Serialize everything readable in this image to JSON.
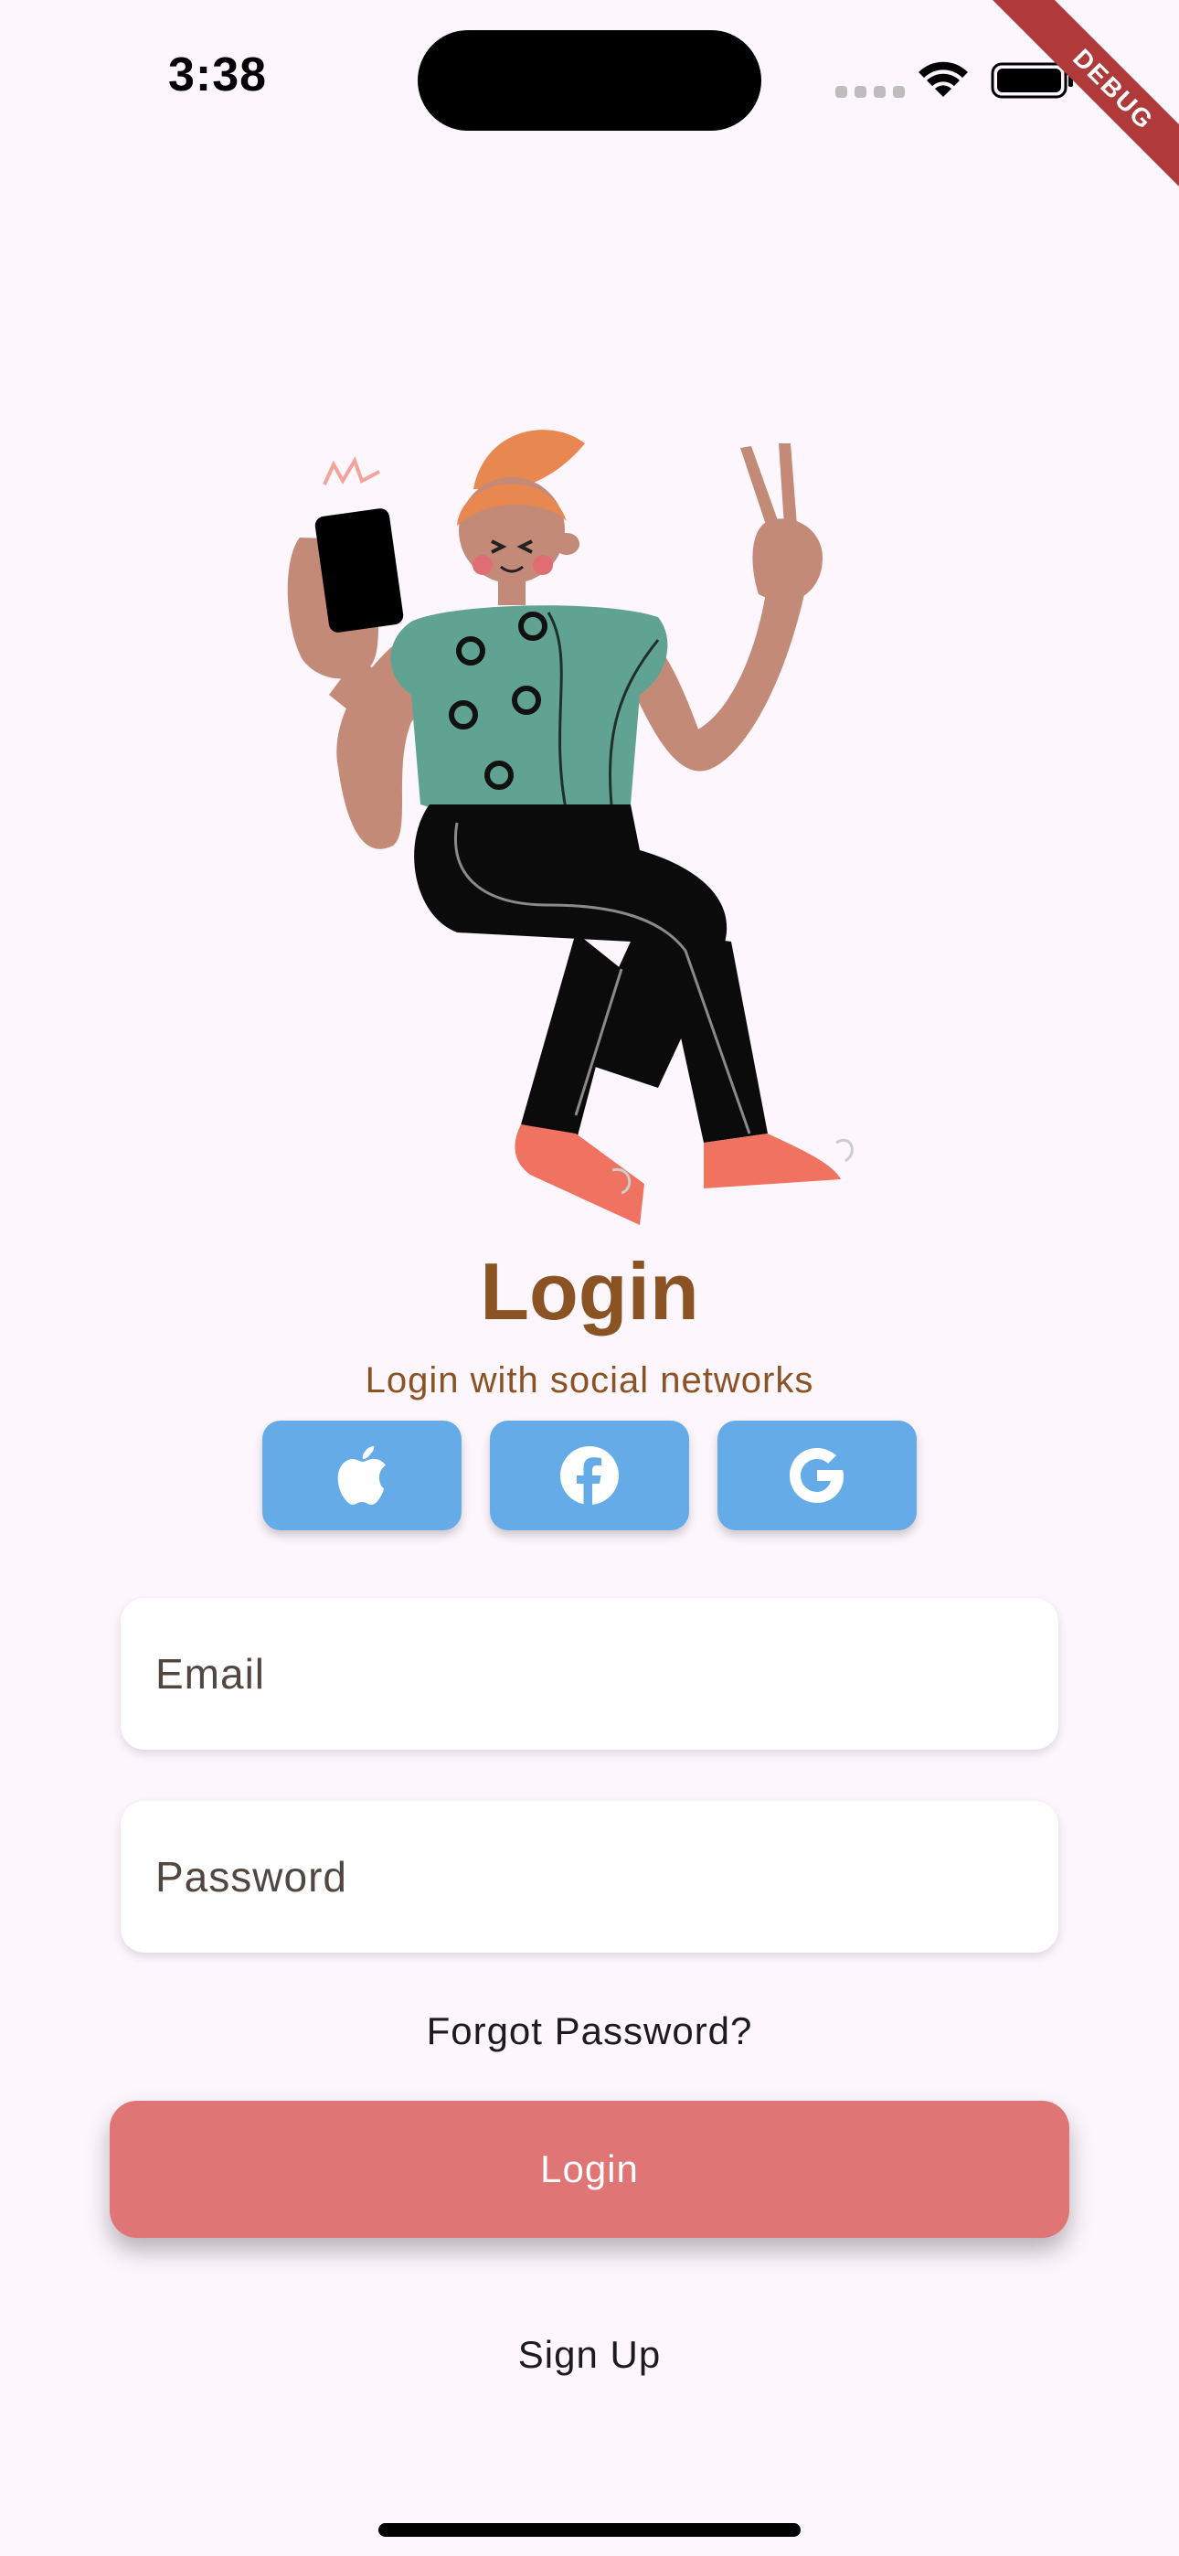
{
  "status_bar": {
    "time": "3:38",
    "debug_label": "DEBUG"
  },
  "colors": {
    "background": "#fdf6fd",
    "title": "#8b5323",
    "social_button": "#65abe8",
    "login_button": "#df7675"
  },
  "header": {
    "title": "Login",
    "subtitle": "Login with social networks"
  },
  "social": {
    "buttons": [
      {
        "icon": "apple-icon"
      },
      {
        "icon": "facebook-icon"
      },
      {
        "icon": "google-icon"
      }
    ]
  },
  "form": {
    "email_placeholder": "Email",
    "password_placeholder": "Password",
    "forgot_label": "Forgot Password?",
    "login_label": "Login",
    "signup_label": "Sign Up"
  }
}
